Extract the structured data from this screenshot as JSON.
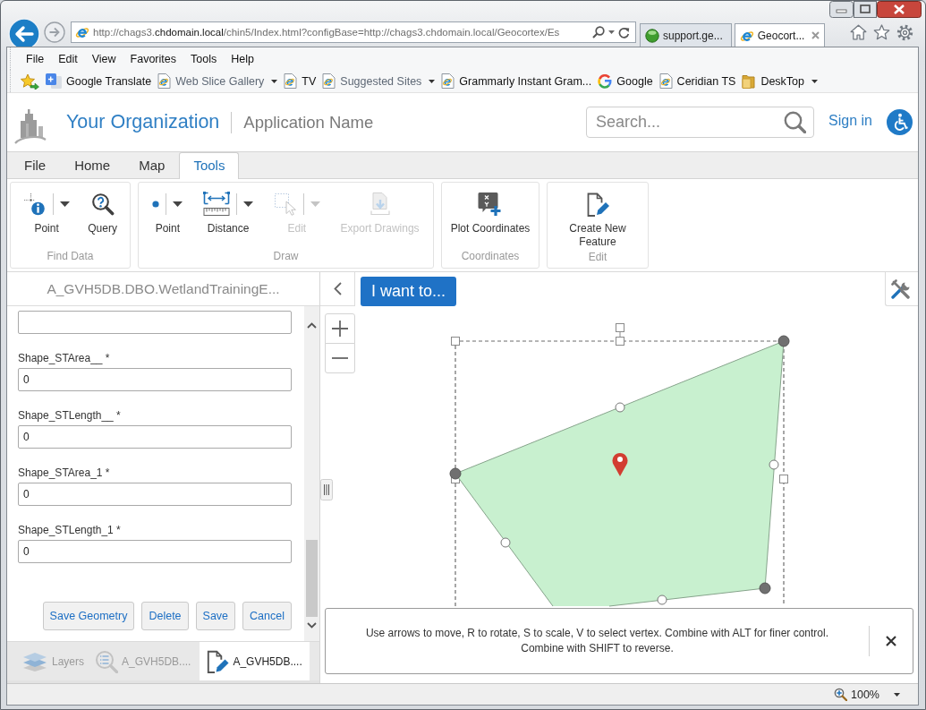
{
  "browser": {
    "address_bar": {
      "url": [
        {
          "text": "http://chags3.",
          "emphasis": false
        },
        {
          "text": "chdomain.local",
          "emphasis": true
        },
        {
          "text": "/chin5/Index.html?configBase=http://chags3.chdomain.local/Geocortex/Es",
          "emphasis": false
        }
      ]
    },
    "tabs": [
      {
        "label": "support.ge...",
        "kind": "orb",
        "selected": false
      },
      {
        "label": "Geocort...",
        "kind": "ie",
        "selected": true
      }
    ],
    "menu_bar": [
      "File",
      "Edit",
      "View",
      "Favorites",
      "Tools",
      "Help"
    ],
    "favorites_bar": [
      {
        "label": "Google Translate",
        "kind": "translate",
        "dimmed": false,
        "has_menu": false
      },
      {
        "label": "Web Slice Gallery",
        "kind": "page",
        "dimmed": true,
        "has_menu": true
      },
      {
        "label": "TV",
        "kind": "page",
        "dimmed": false,
        "has_menu": false
      },
      {
        "label": "Suggested Sites",
        "kind": "page",
        "dimmed": true,
        "has_menu": true
      },
      {
        "label": "Grammarly Instant Gram...",
        "kind": "page",
        "dimmed": false,
        "has_menu": false
      },
      {
        "label": "Google",
        "kind": "google",
        "dimmed": false,
        "has_menu": false
      },
      {
        "label": "Ceridian TS",
        "kind": "page",
        "dimmed": false,
        "has_menu": false
      },
      {
        "label": "DeskTop",
        "kind": "folder",
        "dimmed": false,
        "has_menu": true
      }
    ]
  },
  "app": {
    "header": {
      "organization": "Your Organization",
      "application": "Application Name",
      "search": {
        "placeholder": "Search..."
      },
      "sign_in": "Sign in"
    },
    "ribbon": {
      "tabs": [
        {
          "label": "File",
          "selected": false
        },
        {
          "label": "Home",
          "selected": false
        },
        {
          "label": "Map",
          "selected": false
        },
        {
          "label": "Tools",
          "selected": true
        }
      ],
      "groups": [
        {
          "title": "Find Data",
          "tools": [
            {
              "label": "Point",
              "kind": "identify",
              "has_menu": true,
              "disabled": false
            },
            {
              "label": "Query",
              "kind": "query",
              "has_menu": false,
              "disabled": false
            }
          ]
        },
        {
          "title": "Draw",
          "tools": [
            {
              "label": "Point",
              "kind": "point",
              "has_menu": true,
              "disabled": false
            },
            {
              "label": "Distance",
              "kind": "distance",
              "has_menu": true,
              "disabled": false
            },
            {
              "label": "Edit",
              "kind": "edit",
              "has_menu": true,
              "disabled": true
            },
            {
              "label": "Export Drawings",
              "kind": "export",
              "has_menu": false,
              "disabled": true
            }
          ]
        },
        {
          "title": "Coordinates",
          "tools": [
            {
              "label": "Plot Coordinates",
              "kind": "plot",
              "has_menu": false,
              "disabled": false
            }
          ]
        },
        {
          "title": "Edit",
          "tools": [
            {
              "label": "Create New Feature",
              "kind": "create",
              "has_menu": false,
              "disabled": false
            }
          ]
        }
      ]
    },
    "panel": {
      "title": "A_GVH5DB.DBO.WetlandTrainingE...",
      "fields": [
        {
          "kind": "text"
        },
        {
          "kind": "text",
          "label": "Shape_STArea__ *",
          "value": "0"
        },
        {
          "kind": "text",
          "label": "Shape_STLength__ *",
          "value": "0"
        },
        {
          "kind": "text",
          "label": "Shape_STArea_1 *",
          "value": "0"
        },
        {
          "kind": "text",
          "label": "Shape_STLength_1 *",
          "value": "0"
        }
      ],
      "buttons": [
        "Save Geometry",
        "Delete",
        "Save",
        "Cancel"
      ],
      "tabs": [
        {
          "label": "Layers",
          "kind": "layers",
          "selected": false
        },
        {
          "label": "A_GVH5DB....",
          "kind": "results",
          "selected": false
        },
        {
          "label": "A_GVH5DB....",
          "kind": "edit",
          "selected": true
        }
      ]
    },
    "map": {
      "i_want_to": "I want to...",
      "hint": "Use arrows to move, R to rotate, S to scale, V to select vertex. Combine with ALT for finer control. Combine with SHIFT to reverse."
    }
  },
  "status_bar": {
    "zoom": "100%"
  }
}
